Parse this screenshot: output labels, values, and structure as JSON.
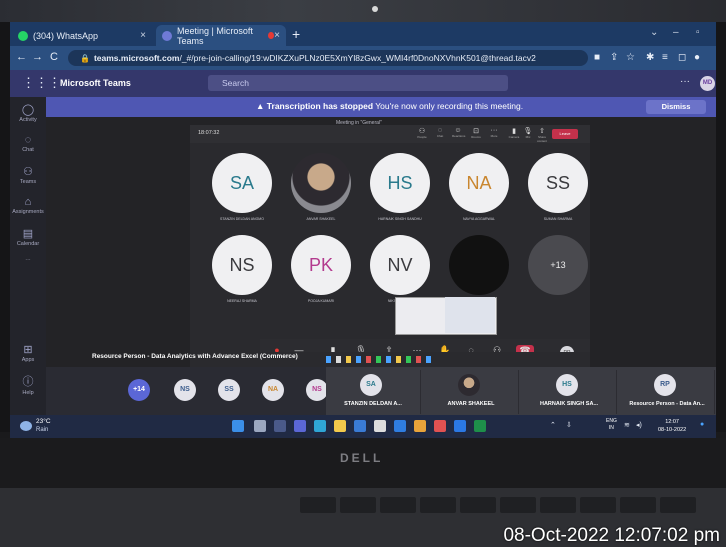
{
  "browser": {
    "tabs": [
      {
        "label": "(304) WhatsApp",
        "icon": "whatsapp-icon",
        "color": "#25d366"
      },
      {
        "label": "Meeting | Microsoft Teams",
        "icon": "teams-icon",
        "color": "#6f7ad6"
      }
    ],
    "new_tab": "+",
    "url_domain": "teams.microsoft.com",
    "url_path": "/_#/pre-join-calling/19:wDIKZXuPLNz0E5XmYl8zGwx_WMI4rf0DnoNXVhnK501@thread.tacv2"
  },
  "teams": {
    "app_name": "Microsoft Teams",
    "search_placeholder": "Search",
    "user_initials": "MD",
    "rail": [
      {
        "label": "Activity",
        "icon": "bell-icon"
      },
      {
        "label": "Chat",
        "icon": "chat-icon"
      },
      {
        "label": "Teams",
        "icon": "teams-people-icon"
      },
      {
        "label": "Assignments",
        "icon": "assignments-icon"
      },
      {
        "label": "Calendar",
        "icon": "calendar-icon"
      },
      {
        "label": "Apps",
        "icon": "apps-icon"
      },
      {
        "label": "Help",
        "icon": "help-icon"
      }
    ],
    "banner": {
      "bold": "Transcription has stopped",
      "text": "You're now only recording this meeting.",
      "dismiss": "Dismiss"
    },
    "meeting_label": "Meeting in \"General\"",
    "inner": {
      "time": "18:07:32",
      "leave": "Leave",
      "controls": [
        "People",
        "Chat",
        "Reactions",
        "Rooms",
        "More",
        "Camera",
        "Mic",
        "Share content"
      ],
      "tiles": [
        {
          "initials": "SA",
          "name": "STANZIN DELDAN ANGMO",
          "bg": "#f0f0f2",
          "fg": "#2a7a8c"
        },
        {
          "initials": "",
          "name": "ANVAR SHAKEEL",
          "kind": "photo"
        },
        {
          "initials": "HS",
          "name": "HARNAIK SINGH SANDHU",
          "bg": "#f0f0f2",
          "fg": "#2a7a8c"
        },
        {
          "initials": "NA",
          "name": "NAVYA AGGARWAL",
          "bg": "#f0f0f2",
          "fg": "#c9862f"
        },
        {
          "initials": "SS",
          "name": "SUMAN SHARMA",
          "bg": "#f0f0f2",
          "fg": "#3b3b3f"
        },
        {
          "initials": "NS",
          "name": "NEERAJ SHARMA",
          "bg": "#f0f0f2",
          "fg": "#3b3b3f"
        },
        {
          "initials": "PK",
          "name": "POOJA KUMARI",
          "bg": "#f0f0f2",
          "fg": "#b33a8e"
        },
        {
          "initials": "NV",
          "name": "NIKITA VERMA",
          "bg": "#f0f0f2",
          "fg": "#3b3b3f"
        },
        {
          "initials": "",
          "name": "",
          "kind": "dark"
        },
        {
          "initials": "+13",
          "name": "",
          "kind": "more"
        }
      ],
      "rp": "RP"
    },
    "resource_label": "Resource Person - Data Analytics with Advance Excel (Commerce)",
    "strip_chips": [
      {
        "initials": "+14",
        "kind": "plus"
      },
      {
        "initials": "NS",
        "fg": "#3b5c8c"
      },
      {
        "initials": "SS",
        "fg": "#3b5c8c"
      },
      {
        "initials": "NA",
        "fg": "#c9862f"
      },
      {
        "initials": "NS",
        "fg": "#b33a8e"
      }
    ],
    "cards": [
      {
        "initials": "SA",
        "name": "STANZIN DELDAN A...",
        "fg": "#2a7a8c"
      },
      {
        "initials": "",
        "name": "ANVAR SHAKEEL",
        "fg": "#333"
      },
      {
        "initials": "HS",
        "name": "HARNAIK SINGH SA...",
        "fg": "#2a7a8c"
      },
      {
        "initials": "RP",
        "name": "Resource Person - Data An...",
        "fg": "#3b5c8c"
      }
    ]
  },
  "taskbar": {
    "temperature": "23°C",
    "condition": "Rain",
    "lang_line1": "ENG",
    "lang_line2": "IN",
    "time": "12:07",
    "date": "08-10-2022"
  },
  "laptop": {
    "brand": "DELL"
  },
  "photo_timestamp": "08-Oct-2022 12:07:02 pm"
}
